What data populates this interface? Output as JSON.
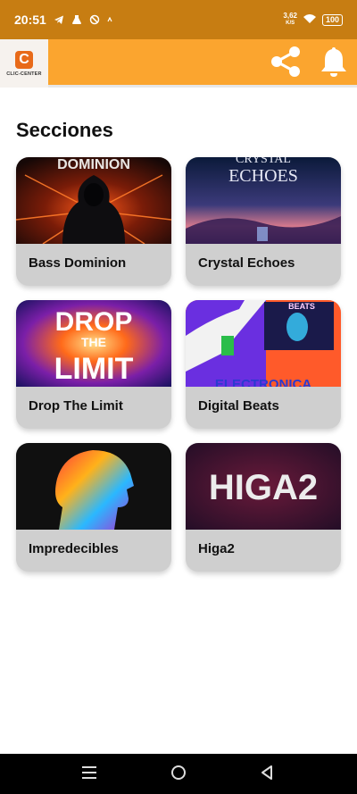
{
  "status_bar": {
    "time": "20:51",
    "speed_value": "3,62",
    "speed_unit": "K/S",
    "battery": "100"
  },
  "app_bar": {
    "logo_letter": "C",
    "logo_text": "CLIC-CENTER"
  },
  "main": {
    "section_title": "Secciones",
    "cards": [
      {
        "label": "Bass Dominion",
        "art_text": "DOMINION"
      },
      {
        "label": "Crystal Echoes",
        "art_text_1": "CRYSTAL",
        "art_text_2": "ECHOES"
      },
      {
        "label": "Drop The Limit",
        "art_text_1": "DROP",
        "art_text_2": "THE",
        "art_text_3": "LIMIT"
      },
      {
        "label": "Digital Beats",
        "art_text_1": "BEATS",
        "art_text_2": "ELECTRONICA"
      },
      {
        "label": "Impredecibles"
      },
      {
        "label": "Higa2",
        "art_text": "HIGA2"
      }
    ]
  },
  "colors": {
    "status_bar": "#c77d12",
    "app_bar": "#fba52f",
    "card_bg": "#cfcfcf",
    "nav_bar": "#000000"
  }
}
